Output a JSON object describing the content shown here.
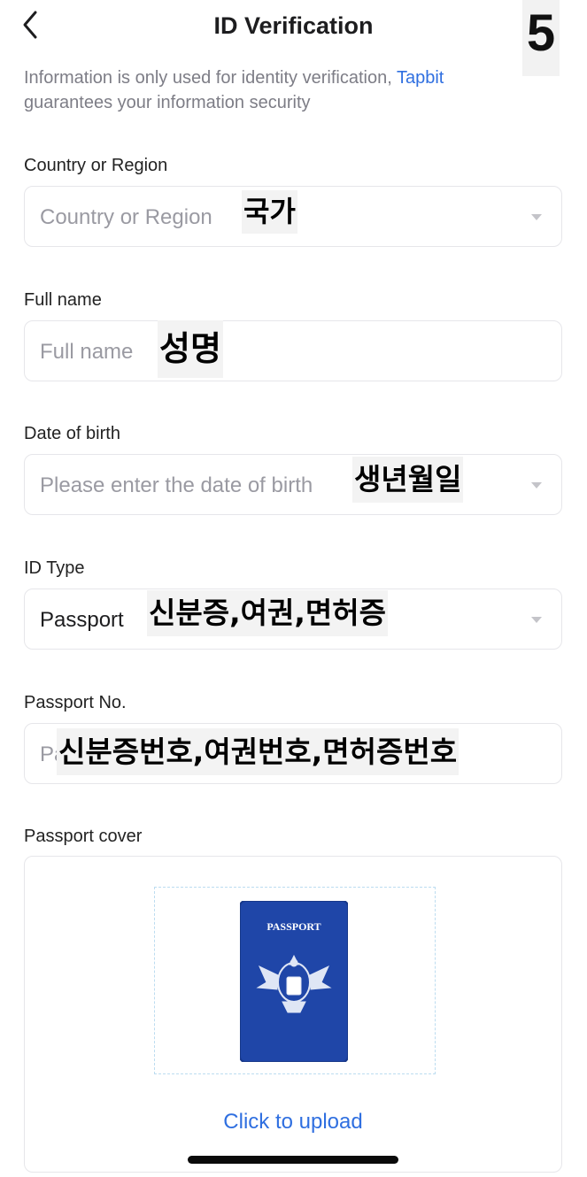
{
  "header": {
    "title": "ID Verification",
    "step_badge": "5"
  },
  "notice": {
    "text_before": "Information is only used for identity verification, ",
    "link": "Tapbit",
    "text_after": " guarantees your information security"
  },
  "fields": {
    "country": {
      "label": "Country or Region",
      "placeholder": "Country or Region",
      "annotation": "국가"
    },
    "full_name": {
      "label": "Full name",
      "placeholder": "Full name",
      "annotation": "성명"
    },
    "dob": {
      "label": "Date of birth",
      "placeholder": "Please enter the date of birth",
      "annotation": "생년월일"
    },
    "id_type": {
      "label": "ID Type",
      "value": "Passport",
      "annotation": "신분증,여권,면허증"
    },
    "passport_no": {
      "label": "Passport No.",
      "placeholder": "Passport number",
      "annotation": "신분증번호,여권번호,면허증번호"
    }
  },
  "upload": {
    "label": "Passport cover",
    "image_text": "PASSPORT",
    "link": "Click to upload"
  },
  "colors": {
    "accent": "#2f6fe0",
    "passport_blue": "#1f46a8"
  }
}
